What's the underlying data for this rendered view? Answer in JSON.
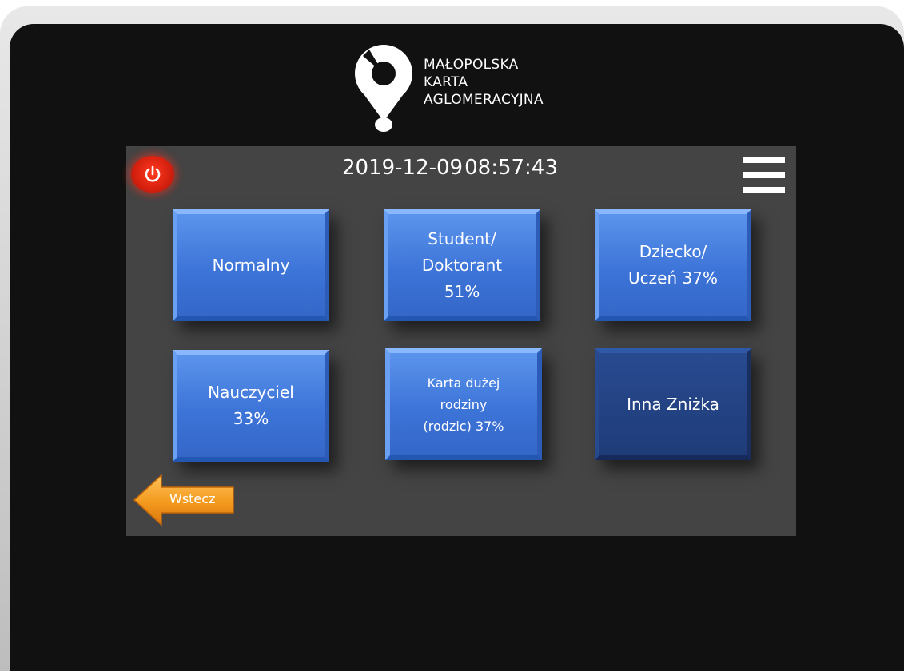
{
  "brand": {
    "lines": [
      "MAŁOPOLSKA",
      "KARTA",
      "AGLOMERACYJNA"
    ]
  },
  "header": {
    "date": "2019-12-09",
    "time": "08:57:43"
  },
  "tiles": [
    {
      "lines": [
        "Normalny"
      ]
    },
    {
      "lines": [
        "Student/",
        "Doktorant",
        "51%"
      ]
    },
    {
      "lines": [
        "Dziecko/",
        "Uczeń 37%"
      ]
    },
    {
      "lines": [
        "Nauczyciel",
        "33%"
      ]
    },
    {
      "lines": [
        "Karta dużej",
        "rodziny",
        "(rodzic) 37%"
      ]
    },
    {
      "lines": [
        "Inna Zniżka"
      ]
    }
  ],
  "back_label": "Wstecz",
  "icons": {
    "power": "power-icon",
    "menu": "hamburger-menu-icon",
    "back": "arrow-left-icon",
    "logo": "map-pin-logo-icon"
  },
  "colors": {
    "tile_blue": "#3d74d8",
    "tile_selected": "#1f3c79",
    "power_red": "#d4200e",
    "back_orange": "#f39a1e",
    "screen_bg": "#444444",
    "bezel": "#111111"
  }
}
